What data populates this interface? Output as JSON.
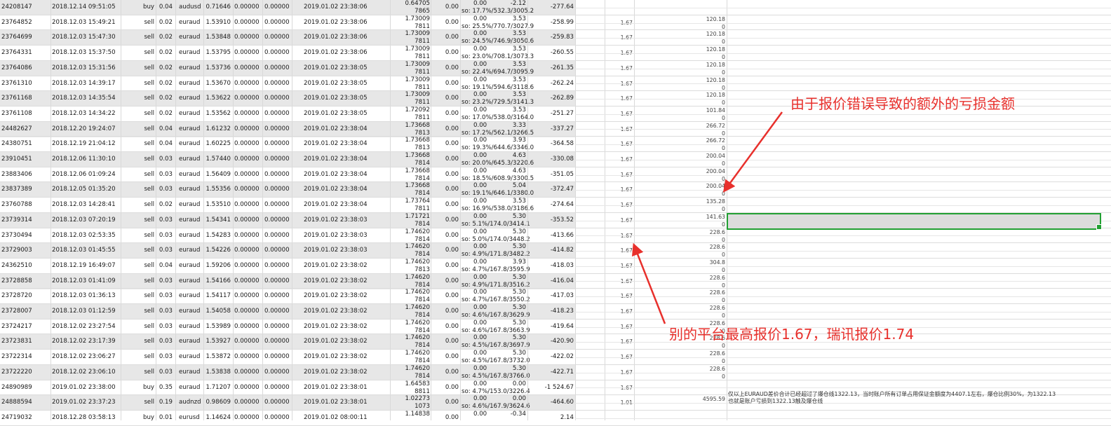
{
  "rows": [
    {
      "id": "24208147",
      "time": "2018.12.14 09:51:05",
      "type": "buy",
      "size": "0.04",
      "symbol": "audusd",
      "open": "0.71646",
      "sl": "0.00000",
      "tp": "0.00000",
      "close_time": "2019.01.02 23:38:06",
      "close_price": "0.64705",
      "close_price2": "7865",
      "comm": "0.00",
      "tax": "0.00",
      "swap": "-2.12",
      "so": "so: 17.7%/532.3/3005.2",
      "profit": "-277.64",
      "rate": "",
      "extra": "",
      "extra2": ""
    },
    {
      "id": "23764852",
      "time": "2018.12.03 15:49:21",
      "type": "sell",
      "size": "0.02",
      "symbol": "euraud",
      "open": "1.53910",
      "sl": "0.00000",
      "tp": "0.00000",
      "close_time": "2019.01.02 23:38:06",
      "close_price": "1.73009",
      "close_price2": "7811",
      "comm": "0.00",
      "tax": "0.00",
      "swap": "3.53",
      "so": "so: 25.5%/770.7/3027.9",
      "profit": "-258.99",
      "rate": "1.67",
      "extra": "120.18",
      "extra2": "0"
    },
    {
      "id": "23764699",
      "time": "2018.12.03 15:47:30",
      "type": "sell",
      "size": "0.02",
      "symbol": "euraud",
      "open": "1.53848",
      "sl": "0.00000",
      "tp": "0.00000",
      "close_time": "2019.01.02 23:38:06",
      "close_price": "1.73009",
      "close_price2": "7811",
      "comm": "0.00",
      "tax": "0.00",
      "swap": "3.53",
      "so": "so: 24.5%/746.9/3050.6",
      "profit": "-259.83",
      "rate": "1.67",
      "extra": "120.18",
      "extra2": "0"
    },
    {
      "id": "23764331",
      "time": "2018.12.03 15:37:50",
      "type": "sell",
      "size": "0.02",
      "symbol": "euraud",
      "open": "1.53795",
      "sl": "0.00000",
      "tp": "0.00000",
      "close_time": "2019.01.02 23:38:06",
      "close_price": "1.73009",
      "close_price2": "7811",
      "comm": "0.00",
      "tax": "0.00",
      "swap": "3.53",
      "so": "so: 23.0%/708.1/3073.3",
      "profit": "-260.55",
      "rate": "1.67",
      "extra": "120.18",
      "extra2": "0"
    },
    {
      "id": "23764086",
      "time": "2018.12.03 15:31:56",
      "type": "sell",
      "size": "0.02",
      "symbol": "euraud",
      "open": "1.53736",
      "sl": "0.00000",
      "tp": "0.00000",
      "close_time": "2019.01.02 23:38:05",
      "close_price": "1.73009",
      "close_price2": "7811",
      "comm": "0.00",
      "tax": "0.00",
      "swap": "3.53",
      "so": "so: 22.4%/694.7/3095.9",
      "profit": "-261.35",
      "rate": "1.67",
      "extra": "120.18",
      "extra2": "0"
    },
    {
      "id": "23761310",
      "time": "2018.12.03 14:39:17",
      "type": "sell",
      "size": "0.02",
      "symbol": "euraud",
      "open": "1.53670",
      "sl": "0.00000",
      "tp": "0.00000",
      "close_time": "2019.01.02 23:38:05",
      "close_price": "1.73009",
      "close_price2": "7811",
      "comm": "0.00",
      "tax": "0.00",
      "swap": "3.53",
      "so": "so: 19.1%/594.6/3118.6",
      "profit": "-262.24",
      "rate": "1.67",
      "extra": "120.18",
      "extra2": "0"
    },
    {
      "id": "23761168",
      "time": "2018.12.03 14:35:54",
      "type": "sell",
      "size": "0.02",
      "symbol": "euraud",
      "open": "1.53622",
      "sl": "0.00000",
      "tp": "0.00000",
      "close_time": "2019.01.02 23:38:05",
      "close_price": "1.73009",
      "close_price2": "7811",
      "comm": "0.00",
      "tax": "0.00",
      "swap": "3.53",
      "so": "so: 23.2%/729.5/3141.3",
      "profit": "-262.89",
      "rate": "1.67",
      "extra": "120.18",
      "extra2": "0"
    },
    {
      "id": "23761108",
      "time": "2018.12.03 14:34:22",
      "type": "sell",
      "size": "0.02",
      "symbol": "euraud",
      "open": "1.53562",
      "sl": "0.00000",
      "tp": "0.00000",
      "close_time": "2019.01.02 23:38:05",
      "close_price": "1.72092",
      "close_price2": "7811",
      "comm": "0.00",
      "tax": "0.00",
      "swap": "3.53",
      "so": "so: 17.0%/538.0/3164.0",
      "profit": "-251.27",
      "rate": "1.67",
      "extra": "101.84",
      "extra2": "0"
    },
    {
      "id": "24482627",
      "time": "2018.12.20 19:24:07",
      "type": "sell",
      "size": "0.04",
      "symbol": "euraud",
      "open": "1.61232",
      "sl": "0.00000",
      "tp": "0.00000",
      "close_time": "2019.01.02 23:38:04",
      "close_price": "1.73668",
      "close_price2": "7813",
      "comm": "0.00",
      "tax": "0.00",
      "swap": "3.33",
      "so": "so: 17.2%/562.1/3266.5",
      "profit": "-337.27",
      "rate": "1.67",
      "extra": "266.72",
      "extra2": "0"
    },
    {
      "id": "24380751",
      "time": "2018.12.19 21:04:12",
      "type": "sell",
      "size": "0.04",
      "symbol": "euraud",
      "open": "1.60225",
      "sl": "0.00000",
      "tp": "0.00000",
      "close_time": "2019.01.02 23:38:04",
      "close_price": "1.73668",
      "close_price2": "7813",
      "comm": "0.00",
      "tax": "0.00",
      "swap": "3.93",
      "so": "so: 19.3%/644.6/3346.0",
      "profit": "-364.58",
      "rate": "1.67",
      "extra": "266.72",
      "extra2": "0"
    },
    {
      "id": "23910451",
      "time": "2018.12.06 11:30:10",
      "type": "sell",
      "size": "0.03",
      "symbol": "euraud",
      "open": "1.57440",
      "sl": "0.00000",
      "tp": "0.00000",
      "close_time": "2019.01.02 23:38:04",
      "close_price": "1.73668",
      "close_price2": "7814",
      "comm": "0.00",
      "tax": "0.00",
      "swap": "4.63",
      "so": "so: 20.0%/645.3/3220.6",
      "profit": "-330.08",
      "rate": "1.67",
      "extra": "200.04",
      "extra2": "0"
    },
    {
      "id": "23883406",
      "time": "2018.12.06 01:09:24",
      "type": "sell",
      "size": "0.03",
      "symbol": "euraud",
      "open": "1.56409",
      "sl": "0.00000",
      "tp": "0.00000",
      "close_time": "2019.01.02 23:38:04",
      "close_price": "1.73668",
      "close_price2": "7814",
      "comm": "0.00",
      "tax": "0.00",
      "swap": "4.63",
      "so": "so: 18.5%/608.9/3300.5",
      "profit": "-351.05",
      "rate": "1.67",
      "extra": "200.04",
      "extra2": "0"
    },
    {
      "id": "23837389",
      "time": "2018.12.05 01:35:20",
      "type": "sell",
      "size": "0.03",
      "symbol": "euraud",
      "open": "1.55356",
      "sl": "0.00000",
      "tp": "0.00000",
      "close_time": "2019.01.02 23:38:04",
      "close_price": "1.73668",
      "close_price2": "7814",
      "comm": "0.00",
      "tax": "0.00",
      "swap": "5.04",
      "so": "so: 19.1%/646.1/3380.0",
      "profit": "-372.47",
      "rate": "1.67",
      "extra": "200.04",
      "extra2": "0"
    },
    {
      "id": "23760788",
      "time": "2018.12.03 14:28:41",
      "type": "sell",
      "size": "0.02",
      "symbol": "euraud",
      "open": "1.53510",
      "sl": "0.00000",
      "tp": "0.00000",
      "close_time": "2019.01.02 23:38:04",
      "close_price": "1.73764",
      "close_price2": "7811",
      "comm": "0.00",
      "tax": "0.00",
      "swap": "3.53",
      "so": "so: 16.9%/538.0/3186.6",
      "profit": "-274.64",
      "rate": "1.67",
      "extra": "135.28",
      "extra2": "0"
    },
    {
      "id": "23739314",
      "time": "2018.12.03 07:20:19",
      "type": "sell",
      "size": "0.03",
      "symbol": "euraud",
      "open": "1.54341",
      "sl": "0.00000",
      "tp": "0.00000",
      "close_time": "2019.01.02 23:38:03",
      "close_price": "1.71721",
      "close_price2": "7814",
      "comm": "0.00",
      "tax": "0.00",
      "swap": "5.30",
      "so": "so: 5.1%/174.0/3414.1",
      "profit": "-353.52",
      "rate": "1.67",
      "extra": "141.63",
      "extra2": "0"
    },
    {
      "id": "23730494",
      "time": "2018.12.03 02:53:35",
      "type": "sell",
      "size": "0.03",
      "symbol": "euraud",
      "open": "1.54283",
      "sl": "0.00000",
      "tp": "0.00000",
      "close_time": "2019.01.02 23:38:03",
      "close_price": "1.74620",
      "close_price2": "7814",
      "comm": "0.00",
      "tax": "0.00",
      "swap": "5.30",
      "so": "so: 5.0%/174.0/3448.2",
      "profit": "-413.66",
      "rate": "1.67",
      "extra": "228.6",
      "extra2": "0"
    },
    {
      "id": "23729003",
      "time": "2018.12.03 01:45:55",
      "type": "sell",
      "size": "0.03",
      "symbol": "euraud",
      "open": "1.54226",
      "sl": "0.00000",
      "tp": "0.00000",
      "close_time": "2019.01.02 23:38:03",
      "close_price": "1.74620",
      "close_price2": "7814",
      "comm": "0.00",
      "tax": "0.00",
      "swap": "5.30",
      "so": "so: 4.9%/171.8/3482.2",
      "profit": "-414.82",
      "rate": "1.67",
      "extra": "228.6",
      "extra2": "0"
    },
    {
      "id": "24362510",
      "time": "2018.12.19 16:49:07",
      "type": "sell",
      "size": "0.04",
      "symbol": "euraud",
      "open": "1.59206",
      "sl": "0.00000",
      "tp": "0.00000",
      "close_time": "2019.01.02 23:38:02",
      "close_price": "1.74620",
      "close_price2": "7813",
      "comm": "0.00",
      "tax": "0.00",
      "swap": "3.93",
      "so": "so: 4.7%/167.8/3595.9",
      "profit": "-418.03",
      "rate": "1.67",
      "extra": "304.8",
      "extra2": "0"
    },
    {
      "id": "23728858",
      "time": "2018.12.03 01:41:09",
      "type": "sell",
      "size": "0.03",
      "symbol": "euraud",
      "open": "1.54166",
      "sl": "0.00000",
      "tp": "0.00000",
      "close_time": "2019.01.02 23:38:02",
      "close_price": "1.74620",
      "close_price2": "7814",
      "comm": "0.00",
      "tax": "0.00",
      "swap": "5.30",
      "so": "so: 4.9%/171.8/3516.2",
      "profit": "-416.04",
      "rate": "1.67",
      "extra": "228.6",
      "extra2": "0"
    },
    {
      "id": "23728720",
      "time": "2018.12.03 01:36:13",
      "type": "sell",
      "size": "0.03",
      "symbol": "euraud",
      "open": "1.54117",
      "sl": "0.00000",
      "tp": "0.00000",
      "close_time": "2019.01.02 23:38:02",
      "close_price": "1.74620",
      "close_price2": "7814",
      "comm": "0.00",
      "tax": "0.00",
      "swap": "5.30",
      "so": "so: 4.7%/167.8/3550.2",
      "profit": "-417.03",
      "rate": "1.67",
      "extra": "228.6",
      "extra2": "0"
    },
    {
      "id": "23728007",
      "time": "2018.12.03 01:12:59",
      "type": "sell",
      "size": "0.03",
      "symbol": "euraud",
      "open": "1.54058",
      "sl": "0.00000",
      "tp": "0.00000",
      "close_time": "2019.01.02 23:38:02",
      "close_price": "1.74620",
      "close_price2": "7814",
      "comm": "0.00",
      "tax": "0.00",
      "swap": "5.30",
      "so": "so: 4.6%/167.8/3629.9",
      "profit": "-418.23",
      "rate": "1.67",
      "extra": "228.6",
      "extra2": "0"
    },
    {
      "id": "23724217",
      "time": "2018.12.02 23:27:54",
      "type": "sell",
      "size": "0.03",
      "symbol": "euraud",
      "open": "1.53989",
      "sl": "0.00000",
      "tp": "0.00000",
      "close_time": "2019.01.02 23:38:02",
      "close_price": "1.74620",
      "close_price2": "7814",
      "comm": "0.00",
      "tax": "0.00",
      "swap": "5.30",
      "so": "so: 4.6%/167.8/3663.9",
      "profit": "-419.64",
      "rate": "1.67",
      "extra": "228.6",
      "extra2": "0"
    },
    {
      "id": "23723831",
      "time": "2018.12.02 23:17:39",
      "type": "sell",
      "size": "0.03",
      "symbol": "euraud",
      "open": "1.53927",
      "sl": "0.00000",
      "tp": "0.00000",
      "close_time": "2019.01.02 23:38:02",
      "close_price": "1.74620",
      "close_price2": "7814",
      "comm": "0.00",
      "tax": "0.00",
      "swap": "5.30",
      "so": "so: 4.5%/167.8/3697.9",
      "profit": "-420.90",
      "rate": "1.67",
      "extra": "228.6",
      "extra2": "0"
    },
    {
      "id": "23722314",
      "time": "2018.12.02 23:06:27",
      "type": "sell",
      "size": "0.03",
      "symbol": "euraud",
      "open": "1.53872",
      "sl": "0.00000",
      "tp": "0.00000",
      "close_time": "2019.01.02 23:38:02",
      "close_price": "1.74620",
      "close_price2": "7814",
      "comm": "0.00",
      "tax": "0.00",
      "swap": "5.30",
      "so": "so: 4.5%/167.8/3732.0",
      "profit": "-422.02",
      "rate": "1.67",
      "extra": "228.6",
      "extra2": "0"
    },
    {
      "id": "23722220",
      "time": "2018.12.02 23:06:10",
      "type": "sell",
      "size": "0.03",
      "symbol": "euraud",
      "open": "1.53838",
      "sl": "0.00000",
      "tp": "0.00000",
      "close_time": "2019.01.02 23:38:02",
      "close_price": "1.74620",
      "close_price2": "7814",
      "comm": "0.00",
      "tax": "0.00",
      "swap": "5.30",
      "so": "so: 4.5%/167.8/3766.0",
      "profit": "-422.71",
      "rate": "1.67",
      "extra": "228.6",
      "extra2": "0"
    },
    {
      "id": "24890989",
      "time": "2019.01.02 23:38:00",
      "type": "buy",
      "size": "0.35",
      "symbol": "euraud",
      "open": "1.71207",
      "sl": "0.00000",
      "tp": "0.00000",
      "close_time": "2019.01.02 23:38:01",
      "close_price": "1.64583",
      "close_price2": "8811",
      "comm": "0.00",
      "tax": "0.00",
      "swap": "0.00",
      "so": "so: 4.7%/153.0/3226.4",
      "profit": "-1 524.67",
      "rate": "1.67",
      "extra": "",
      "extra2": ""
    },
    {
      "id": "24888594",
      "time": "2019.01.02 23:37:23",
      "type": "sell",
      "size": "0.19",
      "symbol": "audnzd",
      "open": "0.98609",
      "sl": "0.00000",
      "tp": "0.00000",
      "close_time": "2019.01.02 23:38:01",
      "close_price": "1.02273",
      "close_price2": "1073",
      "comm": "0.00",
      "tax": "0.00",
      "swap": "0.00",
      "so": "so: 4.6%/167.9/3624.6",
      "profit": "-464.60",
      "rate": "1.01",
      "extra": "4595.59",
      "extra2": ""
    },
    {
      "id": "24719032",
      "time": "2018.12.28 03:58:13",
      "type": "buy",
      "size": "0.01",
      "symbol": "eurusd",
      "open": "1.14624",
      "sl": "0.00000",
      "tp": "0.00000",
      "close_time": "2019.01.02 08:00:11",
      "close_price": "1.14838",
      "close_price2": "",
      "comm": "0.00",
      "tax": "0.00",
      "swap": "-0.34",
      "so": "",
      "profit": "2.14",
      "rate": "",
      "extra": "",
      "extra2": ""
    }
  ],
  "note": {
    "line1": "仅以上EURAUD差价合计已经超过了爆仓线1322.13，当时账户所有订单占用保证金额度为4407.1左右，爆仓比例30%，为1322.13",
    "line2": "也就是账户亏损到1322.13触及爆仓线"
  },
  "annotations": {
    "extra_loss": "由于报价错误导致的额外的亏损金额",
    "price_compare": "别的平台最高报价1.67，瑞讯报价1.74"
  },
  "colors": {
    "annotation_red": "#e8302c",
    "selection_green": "#22a033",
    "row_shade": "#e7e7e7"
  }
}
